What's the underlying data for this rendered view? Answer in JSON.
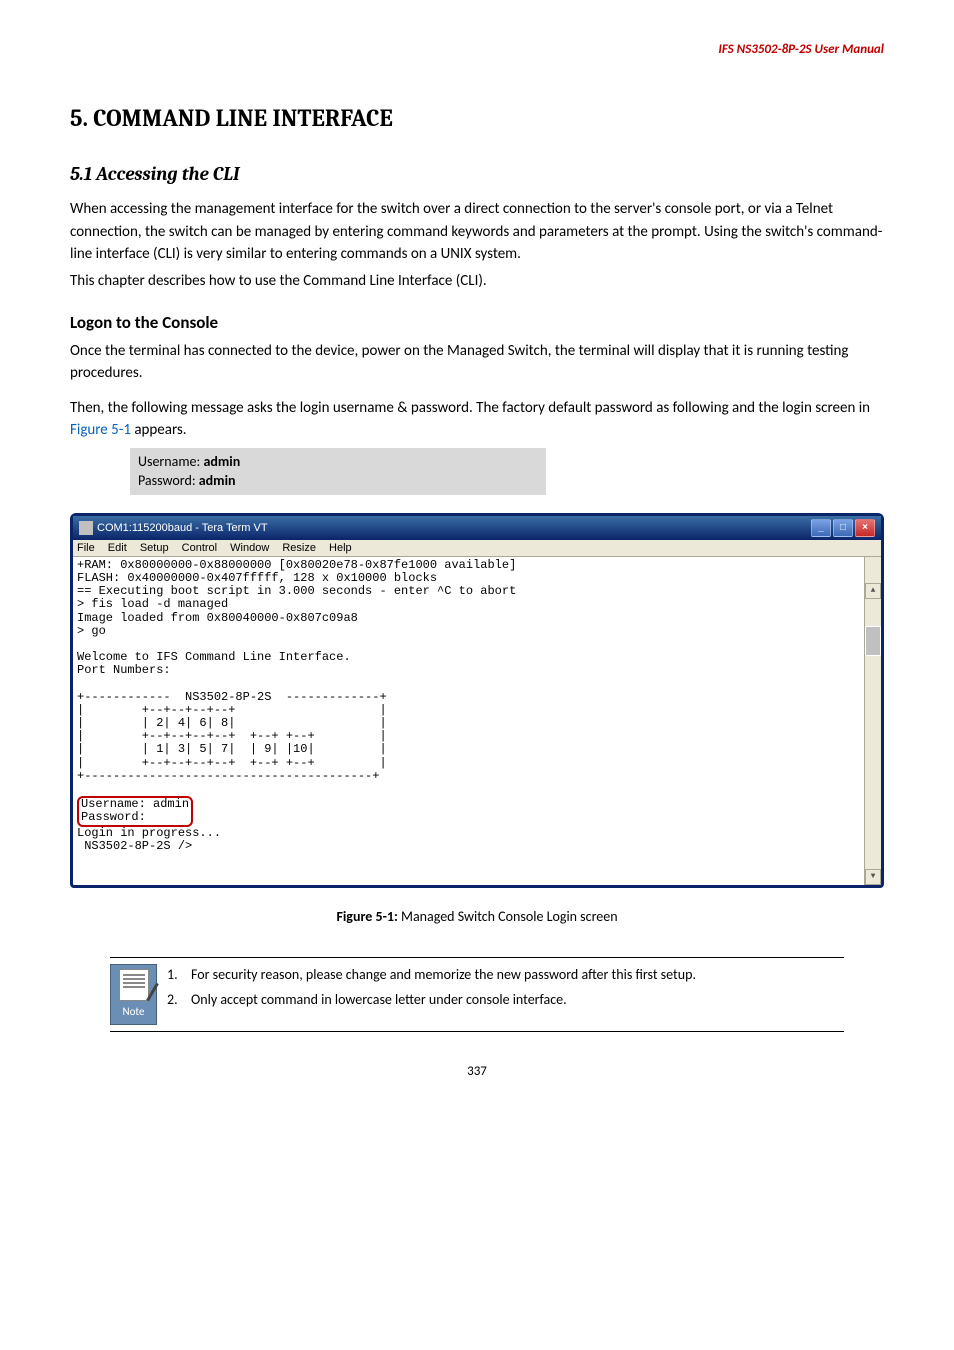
{
  "header": {
    "doc_title": "IFS  NS3502-8P-2S  User  Manual"
  },
  "h1": "5. COMMAND LINE INTERFACE",
  "h2": "5.1 Accessing the CLI",
  "intro_para": "When accessing the management interface for the switch over a direct connection to the server's console port, or via a Telnet connection, the switch can be managed by entering command keywords and parameters at the prompt. Using the switch's command-line interface (CLI) is very similar to entering commands on a UNIX system.",
  "intro_para2": "This chapter describes how to use the Command Line Interface (CLI).",
  "h3": "Logon to the Console",
  "logon_p1": "Once the terminal has connected to the device, power on the Managed Switch, the terminal will display that it is running testing procedures.",
  "logon_p2_a": "Then, the following message asks the login username & password. The factory default password as following and the login screen in ",
  "logon_p2_link": "Figure 5-1",
  "logon_p2_b": " appears.",
  "cred": {
    "u_label": "Username: ",
    "u_val": "admin",
    "p_label": "Password: ",
    "p_val": "admin"
  },
  "terminal": {
    "title": "COM1:115200baud - Tera Term VT",
    "menu": {
      "file": "File",
      "edit": "Edit",
      "setup": "Setup",
      "control": "Control",
      "window": "Window",
      "resize": "Resize",
      "help": "Help"
    },
    "lines_pre": "+RAM: 0x80000000-0x88000000 [0x80020e78-0x87fe1000 available]\nFLASH: 0x40000000-0x407fffff, 128 x 0x10000 blocks\n== Executing boot script in 3.000 seconds - enter ^C to abort\n> fis load -d managed\nImage loaded from 0x80040000-0x807c09a8\n> go\n\nWelcome to IFS Command Line Interface.\nPort Numbers:\n\n+------------  NS3502-8P-2S  -------------+\n|        +--+--+--+--+                    |\n|        | 2| 4| 6| 8|                    |\n|        +--+--+--+--+  +--+ +--+         |\n|        | 1| 3| 5| 7|  | 9| |10|         |\n|        +--+--+--+--+  +--+ +--+         |\n+----------------------------------------+\n",
    "user_line": "Username: admin",
    "pass_line": "Password:",
    "after": "Login in progress...\n NS3502-8P-2S />"
  },
  "figure": {
    "b": "Figure 5-1:",
    "t": " Managed Switch Console Login screen"
  },
  "note": {
    "label": "Note",
    "n1": "1.",
    "t1": "For security reason, please change and memorize the new password after this first setup.",
    "n2": "2.",
    "t2": "Only accept command in lowercase letter under console interface."
  },
  "page_num": "337"
}
